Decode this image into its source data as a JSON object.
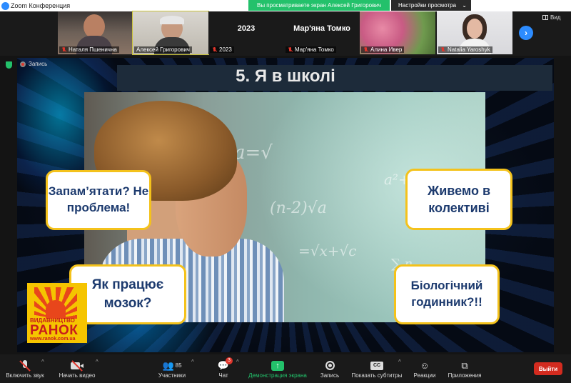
{
  "window": {
    "title": "Zoom Конференция",
    "share_banner": "Вы просматриваете экран Алексей Григорович",
    "view_options": "Настройки просмотра",
    "view_button": "Вид"
  },
  "participants": [
    {
      "name": "Наталя Пшенична",
      "muted": true
    },
    {
      "name": "Алексей Григорович",
      "muted": false,
      "active": true
    },
    {
      "name": "2023",
      "display": "2023",
      "muted": true
    },
    {
      "name": "Мар'яна Томко",
      "display": "Мар'яна Томко",
      "muted": true
    },
    {
      "name": "Алина Ивер",
      "muted": true
    },
    {
      "name": "Natalia Yaroshyk",
      "muted": true
    }
  ],
  "recording": "Запись",
  "slide": {
    "title": "5. Я в школі",
    "bubbles": {
      "top_left": "Запам’ятати? Не проблема!",
      "top_right": "Живемо в колективі",
      "bottom_left": "Як працює мозок?",
      "bottom_right": "Біологічний годинник?!!"
    },
    "publisher": {
      "small": "ВИДАВНИЦТВО",
      "name": "РАНОК",
      "url": "www.ranok.com.ua"
    }
  },
  "toolbar": {
    "mute": "Включить звук",
    "video": "Начать видео",
    "participants": "Участники",
    "participants_count": "85",
    "chat": "Чат",
    "chat_badge": "3",
    "share": "Демонстрация экрана",
    "record": "Запись",
    "captions": "Показать субтитры",
    "reactions": "Реакции",
    "apps": "Приложения",
    "leave": "Выйти"
  },
  "colors": {
    "share_green": "#23c16b",
    "accent_blue": "#2d8cff",
    "bubble_border": "#f4c21b",
    "bubble_text": "#1c3a6e",
    "leave_red": "#d32b1f"
  }
}
